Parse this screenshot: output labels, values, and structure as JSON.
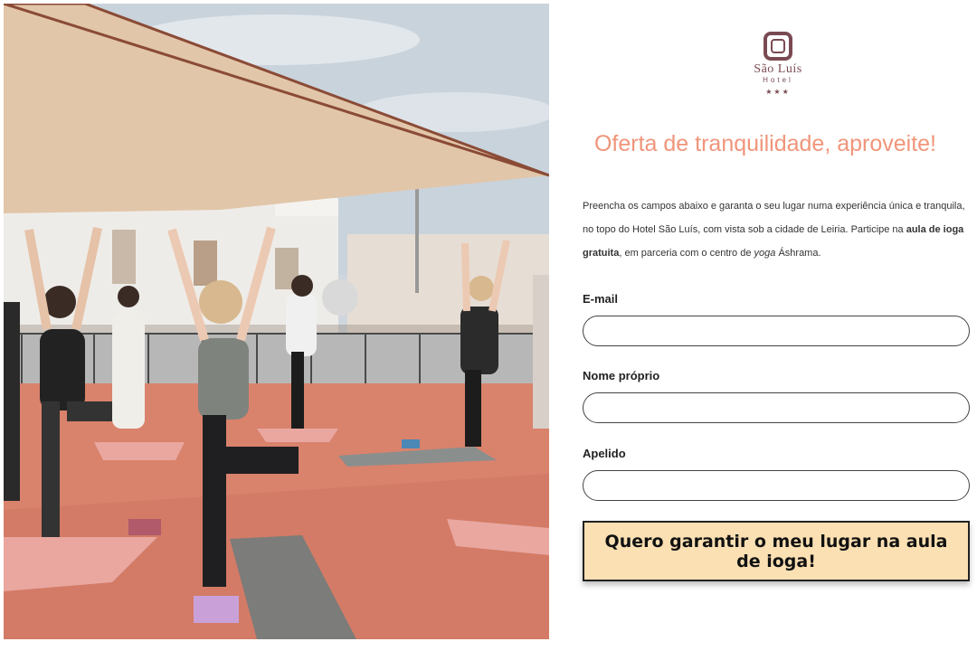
{
  "photo": {
    "alt": "Yoga class on a rooftop terrace"
  },
  "logo": {
    "name": "São Luís",
    "sub": "Hotel",
    "stars": "★★★"
  },
  "headline": "Oferta de tranquilidade, aproveite!",
  "intro": {
    "p1": "Preencha os campos abaixo e garanta o seu lugar numa experiência única e tranquila, no topo do Hotel São Luís, com vista sob a cidade de Leiria. Participe na ",
    "bold": "aula de ioga gratuita",
    "p2": ", em parceria com o centro de ",
    "italic": "yoga",
    "p3": " Áshrama."
  },
  "form": {
    "email_label": "E-mail",
    "email_value": "",
    "first_name_label": "Nome próprio",
    "first_name_value": "",
    "last_name_label": "Apelido",
    "last_name_value": "",
    "submit_label": "Quero garantir o meu lugar na aula de ioga!"
  },
  "colors": {
    "accent": "#f0957a",
    "button_bg": "#fbe0b3",
    "brand": "#7a4a52"
  }
}
